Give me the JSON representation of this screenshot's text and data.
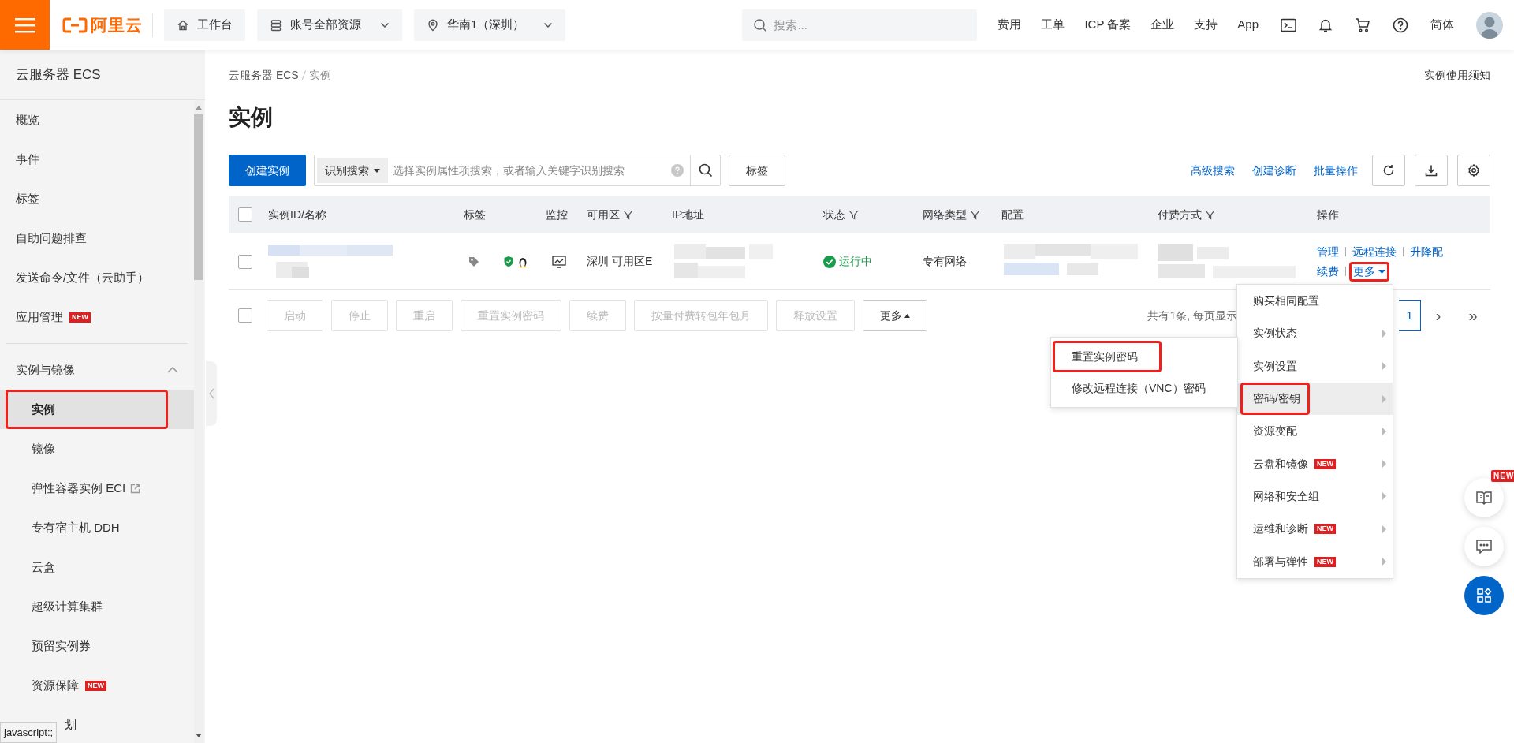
{
  "topbar": {
    "logo": "阿里云",
    "nav": [
      {
        "label": "工作台",
        "dropdown": false
      },
      {
        "label": "账号全部资源",
        "dropdown": true
      },
      {
        "label": "华南1（深圳）",
        "dropdown": true
      }
    ],
    "search": {
      "placeholder": "搜索..."
    },
    "links": [
      "费用",
      "工单",
      "ICP 备案",
      "企业",
      "支持",
      "App"
    ],
    "language": "简体"
  },
  "sidebar": {
    "title": "云服务器 ECS",
    "items": [
      {
        "label": "概览"
      },
      {
        "label": "事件"
      },
      {
        "label": "标签"
      },
      {
        "label": "自助问题排查"
      },
      {
        "label": "发送命令/文件（云助手）"
      },
      {
        "label": "应用管理",
        "badge": "NEW"
      }
    ],
    "groups": [
      {
        "label": "实例与镜像",
        "expanded": true,
        "children": [
          {
            "label": "实例",
            "selected": true,
            "highlighted": true
          },
          {
            "label": "镜像",
            "selected": false,
            "highlighted": false
          },
          {
            "label": "弹性容器实例 ECI",
            "selected": false,
            "highlighted": false,
            "external": true
          },
          {
            "label": "专有宿主机 DDH",
            "selected": false,
            "highlighted": false
          },
          {
            "label": "云盒",
            "selected": false,
            "highlighted": false
          },
          {
            "label": "超级计算集群",
            "selected": false,
            "highlighted": false
          },
          {
            "label": "预留实例券",
            "selected": false,
            "highlighted": false
          },
          {
            "label": "资源保障",
            "selected": false,
            "highlighted": false,
            "badge": "NEW"
          },
          {
            "label": "划",
            "selected": false,
            "highlighted": false
          }
        ]
      }
    ]
  },
  "main": {
    "breadcrumb": [
      "云服务器 ECS",
      "实例"
    ],
    "notice": "实例使用须知",
    "title": "实例",
    "toolbar": {
      "create": "创建实例",
      "search_scope": "识别搜索",
      "search_placeholder": "选择实例属性项搜索，或者输入关键字识别搜索",
      "tag_button": "标签",
      "links": [
        "高级搜索",
        "创建诊断",
        "批量操作"
      ]
    },
    "table": {
      "select_all": {
        "checked": false
      },
      "columns": [
        {
          "label": "实例ID/名称",
          "filter": false
        },
        {
          "label": "标签",
          "filter": false
        },
        {
          "label": "监控",
          "filter": false
        },
        {
          "label": "可用区",
          "filter": true
        },
        {
          "label": "IP地址",
          "filter": false
        },
        {
          "label": "状态",
          "filter": true
        },
        {
          "label": "网络类型",
          "filter": true
        },
        {
          "label": "配置",
          "filter": false
        },
        {
          "label": "付费方式",
          "filter": true
        },
        {
          "label": "操作",
          "filter": false
        }
      ],
      "rows": [
        {
          "selected": false,
          "zone": "深圳 可用区E",
          "status": "运行中",
          "network": "专有网络",
          "actions": [
            "管理",
            "远程连接",
            "升降配",
            "续费"
          ],
          "more": {
            "label": "更多",
            "highlighted": true
          }
        }
      ]
    },
    "bulk_select": {
      "checked": false
    },
    "bulk_actions": [
      {
        "label": "启动",
        "disabled": true
      },
      {
        "label": "停止",
        "disabled": true
      },
      {
        "label": "重启",
        "disabled": true
      },
      {
        "label": "重置实例密码",
        "disabled": true
      },
      {
        "label": "续费",
        "disabled": true
      },
      {
        "label": "按量付费转包年包月",
        "disabled": true
      },
      {
        "label": "释放设置",
        "disabled": true
      },
      {
        "label": "更多",
        "disabled": false
      }
    ],
    "pagination": {
      "summary": "共有1条, 每页显示",
      "pages": [
        {
          "label": "1",
          "selected": true
        }
      ],
      "next": "›",
      "last": "»"
    }
  },
  "more_menu": {
    "items": [
      {
        "label": "购买相同配置",
        "submenu": false,
        "active": false,
        "highlighted": false
      },
      {
        "label": "实例状态",
        "submenu": true,
        "active": false,
        "highlighted": false
      },
      {
        "label": "实例设置",
        "submenu": true,
        "active": false,
        "highlighted": false
      },
      {
        "label": "密码/密钥",
        "submenu": true,
        "active": true,
        "highlighted": true
      },
      {
        "label": "资源变配",
        "submenu": true,
        "active": false,
        "highlighted": false
      },
      {
        "label": "云盘和镜像",
        "submenu": true,
        "active": false,
        "highlighted": false,
        "badge": "NEW"
      },
      {
        "label": "网络和安全组",
        "submenu": true,
        "active": false,
        "highlighted": false
      },
      {
        "label": "运维和诊断",
        "submenu": true,
        "active": false,
        "highlighted": false,
        "badge": "NEW"
      },
      {
        "label": "部署与弹性",
        "submenu": true,
        "active": false,
        "highlighted": false,
        "badge": "NEW"
      }
    ]
  },
  "submenu": {
    "items": [
      {
        "label": "重置实例密码",
        "highlighted": true
      },
      {
        "label": "修改远程连接（VNC）密码",
        "highlighted": false
      }
    ]
  },
  "float_buttons": {
    "badge": "NEW"
  },
  "status_tooltip": "javascript:;"
}
